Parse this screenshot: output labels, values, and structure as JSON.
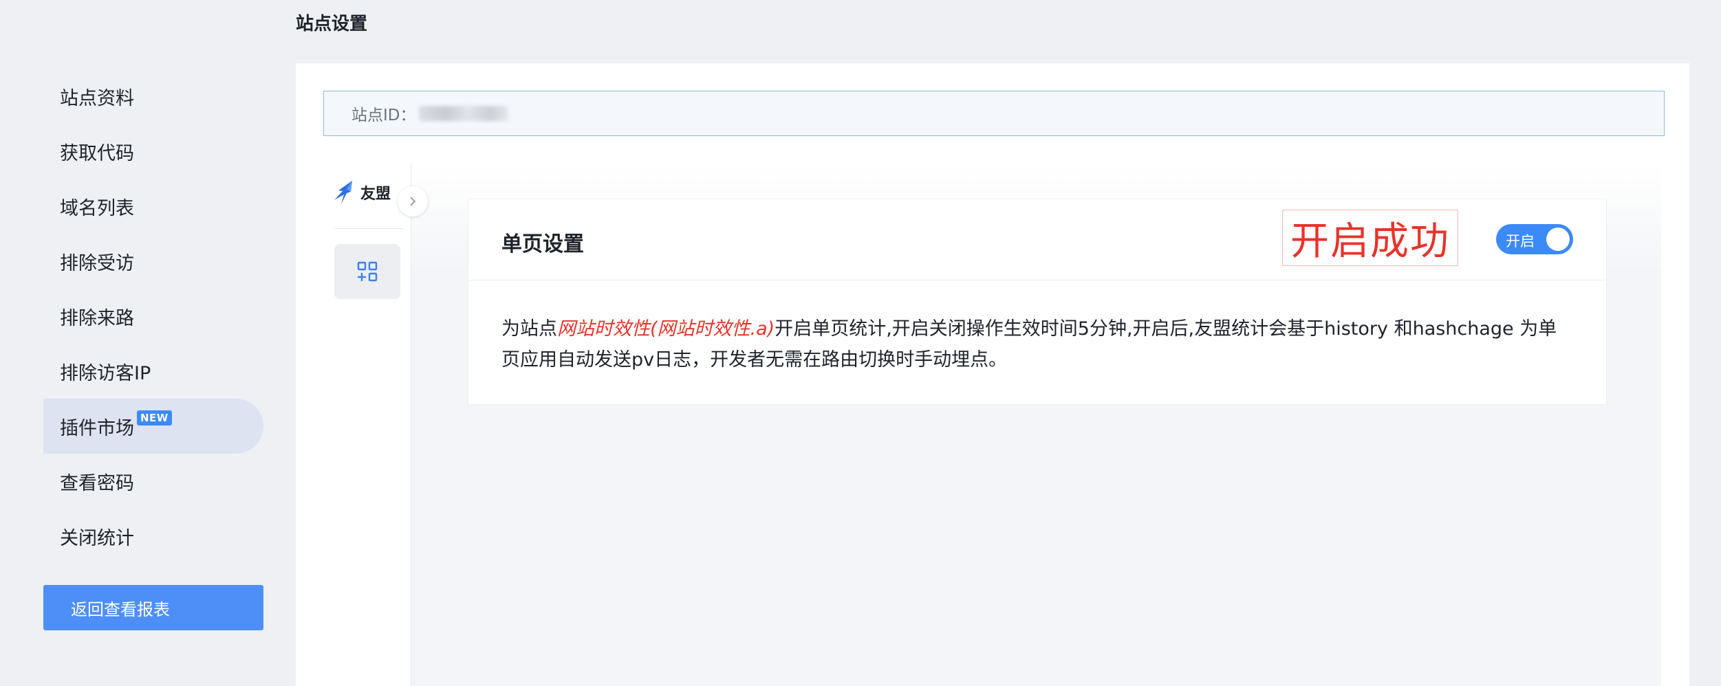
{
  "page": {
    "title": "站点设置"
  },
  "sidebar": {
    "items": [
      {
        "label": "站点资料"
      },
      {
        "label": "获取代码"
      },
      {
        "label": "域名列表"
      },
      {
        "label": "排除受访"
      },
      {
        "label": "排除来路"
      },
      {
        "label": "排除访客IP"
      },
      {
        "label": "插件市场",
        "badge": "NEW"
      },
      {
        "label": "查看密码"
      },
      {
        "label": "关闭统计"
      }
    ],
    "back_button": "返回查看报表"
  },
  "site_id": {
    "label": "站点ID："
  },
  "rail": {
    "brand": "友盟"
  },
  "setting": {
    "title": "单页设置",
    "success_text": "开启成功",
    "toggle_label": "开启",
    "toggle_on": true,
    "desc_prefix": "为站点",
    "site_name": "网站时效性(网站时效性.a)",
    "desc_suffix": "开启单页统计,开启关闭操作生效时间5分钟,开启后,友盟统计会基于history 和hashchage 为单页应用自动发送pv日志，开发者无需在路由切换时手动埋点。"
  },
  "colors": {
    "accent": "#3b8af6",
    "success_red": "#e8332a",
    "active_nav": "#dde3f1"
  }
}
